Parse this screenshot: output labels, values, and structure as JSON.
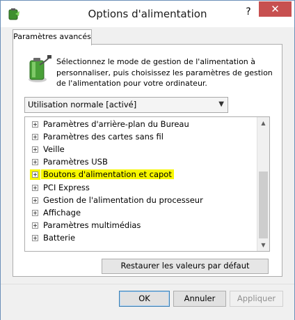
{
  "window": {
    "title": "Options d'alimentation",
    "help_label": "?",
    "close_label": "✕"
  },
  "tab": {
    "label": "Paramètres avancés"
  },
  "description": "Sélectionnez le mode de gestion de l'alimentation à personnaliser, puis choisissez les paramètres de gestion de l'alimentation pour votre ordinateur.",
  "plan_select": {
    "value": "Utilisation normale [activé]"
  },
  "tree": {
    "items": [
      {
        "label": "Paramètres d'arrière-plan du Bureau"
      },
      {
        "label": "Paramètres des cartes sans fil"
      },
      {
        "label": "Veille"
      },
      {
        "label": "Paramètres USB"
      },
      {
        "label": "Boutons d'alimentation et capot",
        "highlighted": true
      },
      {
        "label": "PCI Express"
      },
      {
        "label": "Gestion de l'alimentation du processeur"
      },
      {
        "label": "Affichage"
      },
      {
        "label": "Paramètres multimédias"
      },
      {
        "label": "Batterie"
      }
    ]
  },
  "restore_button": "Restaurer les valeurs par défaut",
  "buttons": {
    "ok": "OK",
    "cancel": "Annuler",
    "apply": "Appliquer"
  },
  "colors": {
    "highlight": "#f7f700",
    "close_button": "#c75050"
  }
}
